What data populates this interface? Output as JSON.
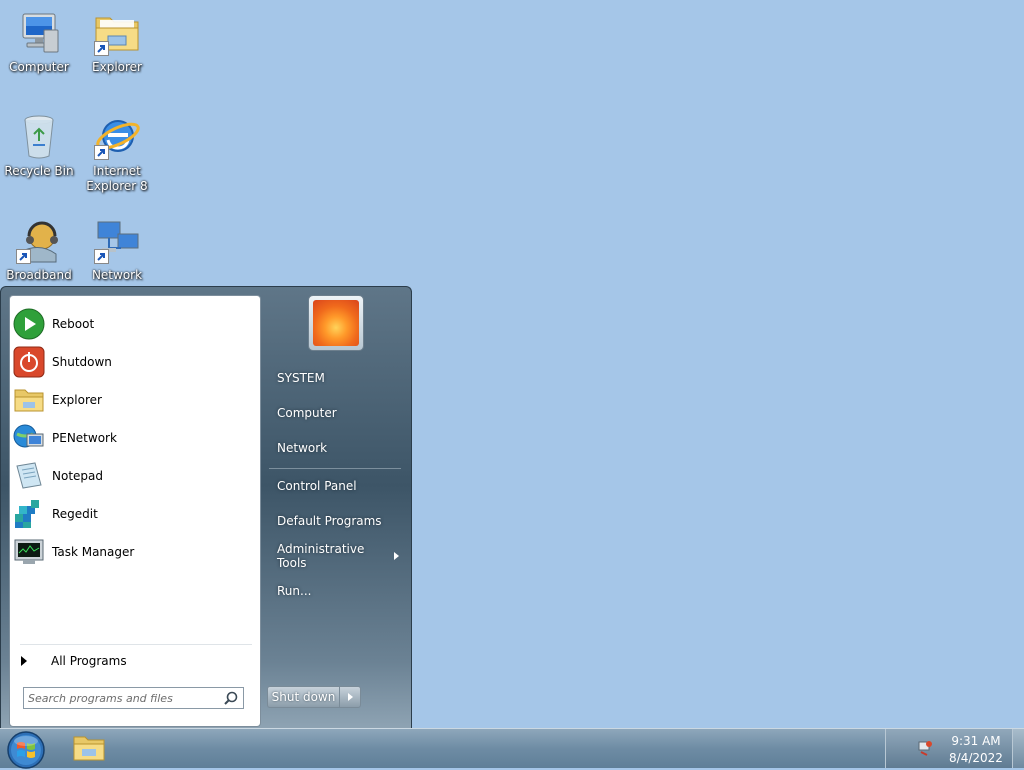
{
  "desktop": {
    "icons": [
      {
        "id": "computer",
        "label": "Computer"
      },
      {
        "id": "explorer",
        "label": "Explorer"
      },
      {
        "id": "recycle-bin",
        "label": "Recycle Bin"
      },
      {
        "id": "internet-explorer",
        "label": "Internet Explorer 8"
      },
      {
        "id": "broadband",
        "label": "Broadband"
      },
      {
        "id": "network",
        "label": "Network"
      }
    ]
  },
  "start_menu": {
    "pinned": [
      {
        "label": "Reboot",
        "icon": "reboot-icon"
      },
      {
        "label": "Shutdown",
        "icon": "shutdown-icon"
      },
      {
        "label": "Explorer",
        "icon": "folder-icon"
      },
      {
        "label": "PENetwork",
        "icon": "pe-network-icon"
      },
      {
        "label": "Notepad",
        "icon": "notepad-icon"
      },
      {
        "label": "Regedit",
        "icon": "regedit-icon"
      },
      {
        "label": "Task Manager",
        "icon": "task-manager-icon"
      }
    ],
    "all_programs": "All Programs",
    "search_placeholder": "Search programs and files",
    "right": [
      {
        "label": "SYSTEM"
      },
      {
        "label": "Computer"
      },
      {
        "label": "Network"
      },
      {
        "label": "Control Panel"
      },
      {
        "label": "Default Programs"
      },
      {
        "label": "Administrative Tools",
        "has_submenu": true
      },
      {
        "label": "Run..."
      }
    ],
    "shutdown_label": "Shut down"
  },
  "taskbar": {
    "time": "9:31 AM",
    "date": "8/4/2022"
  },
  "colors": {
    "desktop_bg": "#a5c6e8",
    "start_menu_dark": "#3d5567",
    "taskbar": "#6e8ca4"
  }
}
